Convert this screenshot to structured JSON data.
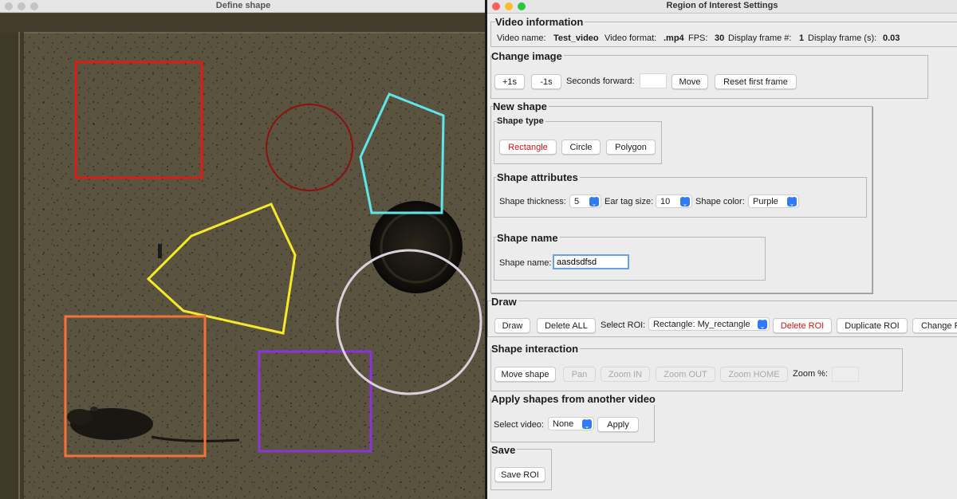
{
  "left_window": {
    "title": "Define shape",
    "shapes": [
      {
        "name": "red-rectangle",
        "color": "#e01b12"
      },
      {
        "name": "dark-red-circle",
        "color": "#8e1010"
      },
      {
        "name": "cyan-polygon",
        "color": "#5ee6ea"
      },
      {
        "name": "yellow-polygon",
        "color": "#f5e92a"
      },
      {
        "name": "orange-rectangle",
        "color": "#f0743a"
      },
      {
        "name": "purple-rectangle",
        "color": "#8a36d6"
      },
      {
        "name": "white-circle",
        "color": "#d8d2dc"
      }
    ]
  },
  "right_window": {
    "title": "Region of Interest Settings",
    "video_info": {
      "legend": "Video information",
      "video_name_label": "Video name:",
      "video_name": "Test_video",
      "video_format_label": "Video format:",
      "video_format": ".mp4",
      "fps_label": "FPS:",
      "fps": "30",
      "display_frame_label": "Display frame #:",
      "display_frame": "1",
      "display_frame_s_label": "Display frame (s):",
      "display_frame_s": "0.03"
    },
    "change_image": {
      "legend": "Change image",
      "plus_label": "+1s",
      "minus_label": "-1s",
      "seconds_forward_label": "Seconds forward:",
      "seconds_forward_value": "",
      "move_label": "Move",
      "reset_label": "Reset first frame"
    },
    "new_shape": {
      "legend": "New shape",
      "shape_type": {
        "legend": "Shape type",
        "rectangle": "Rectangle",
        "circle": "Circle",
        "polygon": "Polygon"
      },
      "shape_attributes": {
        "legend": "Shape attributes",
        "thickness_label": "Shape thickness:",
        "thickness_value": "5",
        "ear_tag_label": "Ear tag size:",
        "ear_tag_value": "10",
        "color_label": "Shape color:",
        "color_value": "Purple"
      },
      "shape_name": {
        "legend": "Shape name",
        "label": "Shape name:",
        "value": "aasdsdfsd"
      }
    },
    "draw": {
      "legend": "Draw",
      "draw_label": "Draw",
      "delete_all_label": "Delete ALL",
      "select_roi_label": "Select ROI:",
      "select_roi_value": "Rectangle: My_rectangle",
      "delete_roi_label": "Delete ROI",
      "duplicate_roi_label": "Duplicate ROI",
      "change_roi_label": "Change R"
    },
    "shape_interaction": {
      "legend": "Shape interaction",
      "move_shape": "Move shape",
      "pan": "Pan",
      "zoom_in": "Zoom IN",
      "zoom_out": "Zoom OUT",
      "zoom_home": "Zoom HOME",
      "zoom_pct_label": "Zoom %:",
      "zoom_pct_value": ""
    },
    "apply_shapes": {
      "legend": "Apply shapes from another video",
      "select_video_label": "Select video:",
      "select_video_value": "None",
      "apply_label": "Apply"
    },
    "save": {
      "legend": "Save",
      "save_roi_label": "Save ROI"
    }
  }
}
